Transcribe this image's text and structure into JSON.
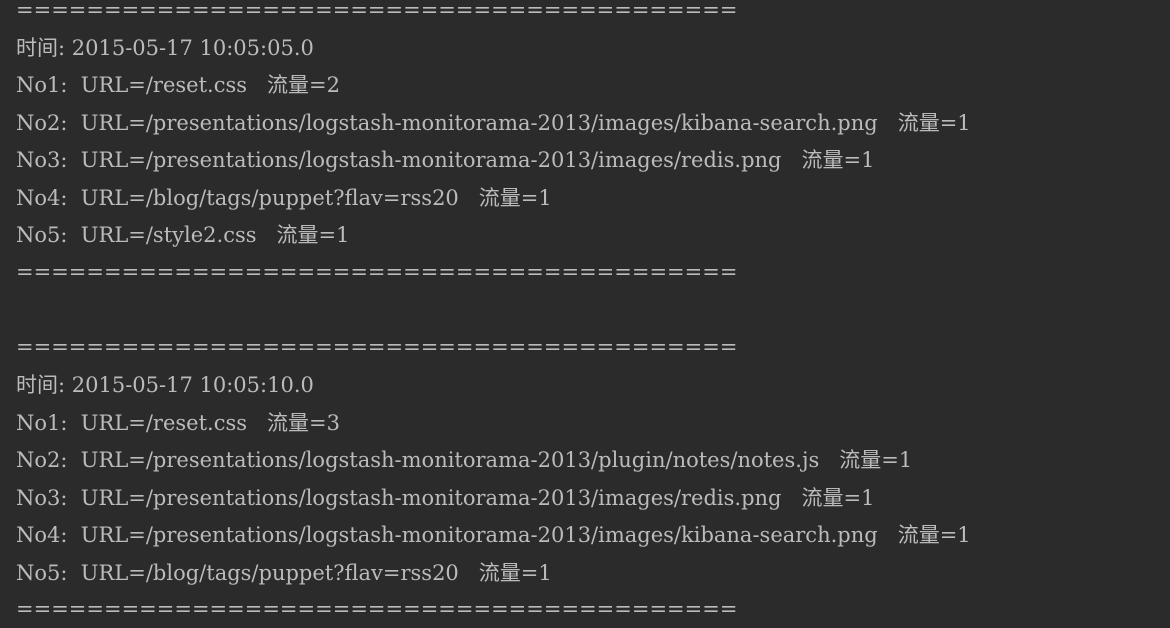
{
  "console": {
    "lines": [
      "=========================================",
      "时间: 2015-05-17 10:05:05.0",
      "No1:  URL=/reset.css   流量=2",
      "No2:  URL=/presentations/logstash-monitorama-2013/images/kibana-search.png   流量=1",
      "No3:  URL=/presentations/logstash-monitorama-2013/images/redis.png   流量=1",
      "No4:  URL=/blog/tags/puppet?flav=rss20   流量=1",
      "No5:  URL=/style2.css   流量=1",
      "=========================================",
      "",
      "=========================================",
      "时间: 2015-05-17 10:05:10.0",
      "No1:  URL=/reset.css   流量=3",
      "No2:  URL=/presentations/logstash-monitorama-2013/plugin/notes/notes.js   流量=1",
      "No3:  URL=/presentations/logstash-monitorama-2013/images/redis.png   流量=1",
      "No4:  URL=/presentations/logstash-monitorama-2013/images/kibana-search.png   流量=1",
      "No5:  URL=/blog/tags/puppet?flav=rss20   流量=1",
      "========================================="
    ]
  }
}
